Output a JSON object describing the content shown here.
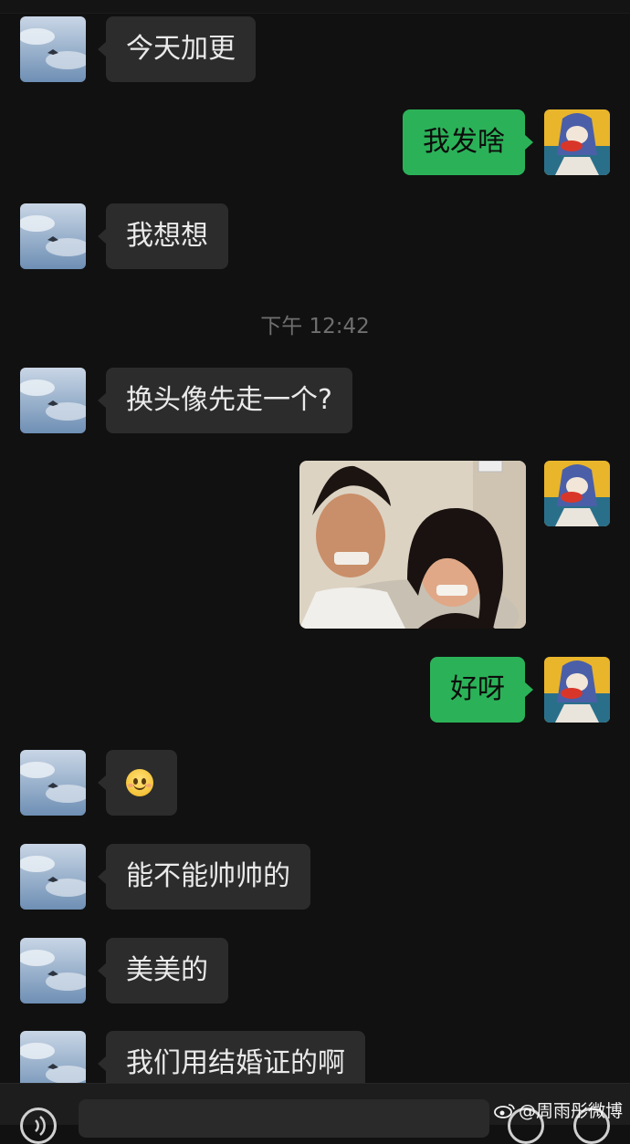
{
  "timestamp": "下午 12:42",
  "messages": [
    {
      "side": "in",
      "text": "今天加更"
    },
    {
      "side": "out",
      "text": "我发啥"
    },
    {
      "side": "in",
      "text": "我想想"
    },
    {
      "side": "in",
      "text": "换头像先走一个?"
    },
    {
      "side": "out",
      "kind": "image",
      "alt": ""
    },
    {
      "side": "out",
      "text": "好呀"
    },
    {
      "side": "in",
      "kind": "emoji",
      "icon": "smile-emoji-icon"
    },
    {
      "side": "in",
      "text": "能不能帅帅的"
    },
    {
      "side": "in",
      "text": "美美的"
    },
    {
      "side": "in",
      "text": "我们用结婚证的啊"
    }
  ],
  "input": {
    "value": "",
    "placeholder": ""
  },
  "watermark": {
    "text": "@周雨彤微博",
    "icon": "weibo-logo-icon"
  },
  "colors": {
    "background": "#111111",
    "incoming_bubble": "#2c2c2c",
    "outgoing_bubble": "#2bb258"
  }
}
